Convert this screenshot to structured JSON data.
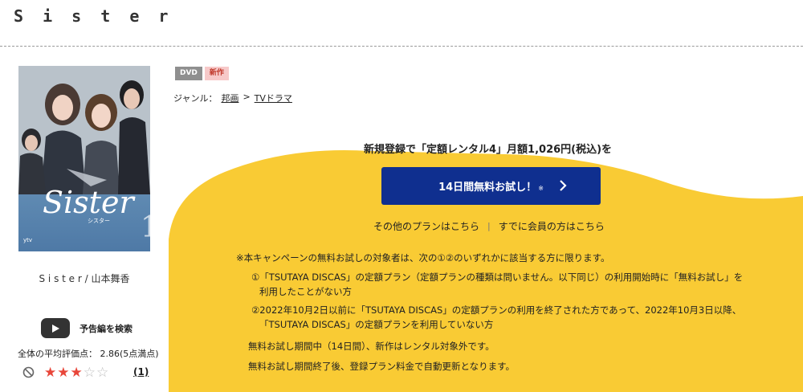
{
  "title": "S i s t e r",
  "jacket": {
    "logo": "Sister",
    "sub": "シスター",
    "network": "ytv",
    "volume": "1"
  },
  "credit": "S i s t e r / 山本舞香",
  "trailer_label": "予告編を検索",
  "rating": {
    "average_text": "全体の平均評価点： 2.86(5点満点)",
    "stars_filled": 3,
    "stars_total": 5,
    "review_count": "(1)"
  },
  "badges": {
    "dvd": "DVD",
    "new": "新作"
  },
  "genre": {
    "label": "ジャンル：",
    "items": [
      "邦画",
      "TVドラマ"
    ],
    "separator": ">"
  },
  "promo": {
    "heading": "新規登録で「定額レンタル4」月額1,026円(税込)を",
    "trial_button": "14日間無料お試し！",
    "trial_mark": "※",
    "other_plans": "その他のプランはこちら",
    "separator": "|",
    "members": "すでに会員の方はこちら"
  },
  "notes": [
    "※本キャンペーンの無料お試しの対象者は、次の①②のいずれかに該当する方に限ります。",
    "①「TSUTAYA DISCAS」の定額プラン（定額プランの種類は問いません。以下同じ）の利用開始時に「無料お試し」を",
    "利用したことがない方",
    "②2022年10月2日以前に「TSUTAYA DISCAS」の定額プランの利用を終了された方であって、2022年10月3日以降、",
    "「TSUTAYA DISCAS」の定額プランを利用していない方",
    "無料お試し期間中（14日間）、新作はレンタル対象外です。",
    "無料お試し期間終了後、登録プラン料金で自動更新となります。"
  ],
  "colors": {
    "accent_yellow": "#f9cb34",
    "button_blue": "#0f2f8f",
    "star": "#e8463a"
  }
}
